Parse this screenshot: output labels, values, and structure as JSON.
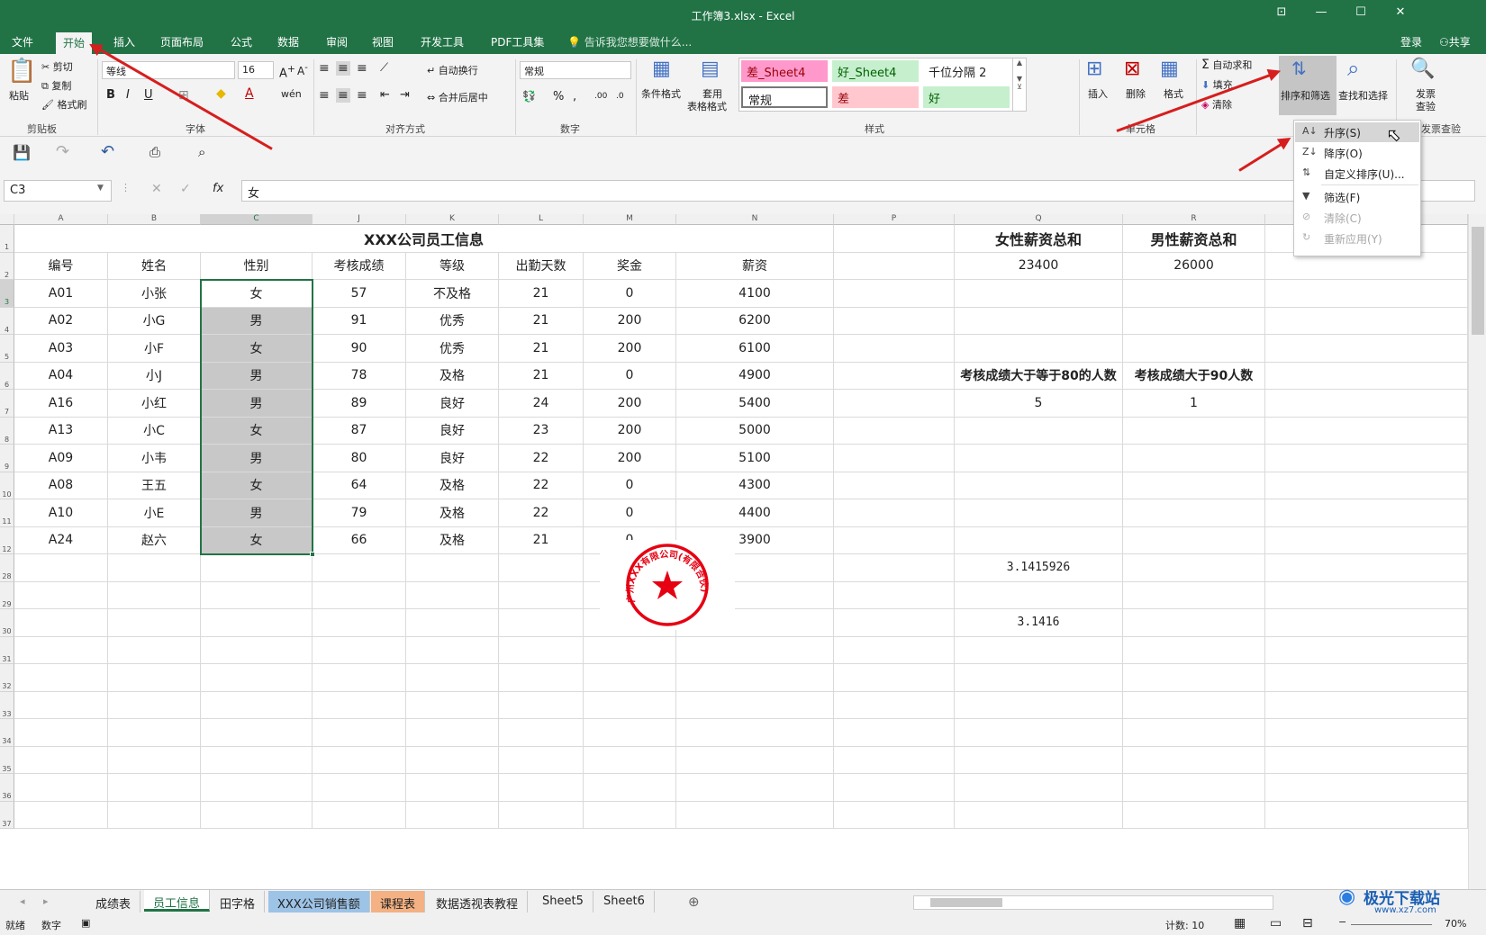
{
  "window": {
    "title": "工作簿3.xlsx - Excel"
  },
  "tabs": [
    "文件",
    "开始",
    "插入",
    "页面布局",
    "公式",
    "数据",
    "审阅",
    "视图",
    "开发工具",
    "PDF工具集"
  ],
  "tell_me": "告诉我您想要做什么...",
  "account": {
    "login": "登录",
    "share": "共享"
  },
  "ribbon": {
    "clipboard": {
      "paste": "粘贴",
      "cut": "剪切",
      "copy": "复制",
      "format_painter": "格式刷",
      "label": "剪贴板"
    },
    "font": {
      "name": "等线",
      "size": "16",
      "label": "字体"
    },
    "alignment": {
      "wrap": "自动换行",
      "merge": "合并后居中",
      "label": "对齐方式"
    },
    "number": {
      "format": "常规",
      "label": "数字"
    },
    "styles": {
      "conditional": "条件格式",
      "table1": "套用",
      "table2": "表格格式",
      "label": "样式",
      "gallery": [
        {
          "text": "差_Sheet4",
          "bg": "#ff99cc",
          "fg": "#9c0006"
        },
        {
          "text": "好_Sheet4",
          "bg": "#c6efce",
          "fg": "#006100"
        },
        {
          "text": "千位分隔 2",
          "bg": "#ffffff",
          "fg": "#222222"
        },
        {
          "text": "常规",
          "bg": "#ffffff",
          "fg": "#222222"
        },
        {
          "text": "差",
          "bg": "#ffc7ce",
          "fg": "#9c0006"
        },
        {
          "text": "好",
          "bg": "#c6efce",
          "fg": "#006100"
        }
      ]
    },
    "cells": {
      "insert": "插入",
      "delete": "删除",
      "format": "格式",
      "label": "单元格"
    },
    "editing": {
      "autosum": "自动求和",
      "fill": "填充",
      "clear": "清除",
      "sort_filter": "排序和筛选",
      "find_select": "查找和选择"
    },
    "invoice": {
      "line1": "发票",
      "line2": "查验",
      "label": "发票查验"
    }
  },
  "namebox": "C3",
  "formula": "女",
  "sheet": {
    "col_letters": [
      "A",
      "B",
      "C",
      "J",
      "K",
      "L",
      "M",
      "N",
      "P",
      "Q",
      "R"
    ],
    "row_numbers": [
      "1",
      "2",
      "3",
      "4",
      "5",
      "6",
      "7",
      "8",
      "9",
      "10",
      "11",
      "12",
      "28",
      "29",
      "30",
      "31",
      "32",
      "33",
      "34",
      "35",
      "36",
      "37"
    ],
    "title": "XXX公司员工信息",
    "headers": [
      "编号",
      "姓名",
      "性别",
      "考核成绩",
      "等级",
      "出勤天数",
      "奖金",
      "薪资"
    ],
    "rows": [
      [
        "A01",
        "小张",
        "女",
        "57",
        "不及格",
        "21",
        "0",
        "4100"
      ],
      [
        "A02",
        "小G",
        "男",
        "91",
        "优秀",
        "21",
        "200",
        "6200"
      ],
      [
        "A03",
        "小F",
        "女",
        "90",
        "优秀",
        "21",
        "200",
        "6100"
      ],
      [
        "A04",
        "小J",
        "男",
        "78",
        "及格",
        "21",
        "0",
        "4900"
      ],
      [
        "A16",
        "小红",
        "男",
        "89",
        "良好",
        "24",
        "200",
        "5400"
      ],
      [
        "A13",
        "小C",
        "女",
        "87",
        "良好",
        "23",
        "200",
        "5000"
      ],
      [
        "A09",
        "小韦",
        "男",
        "80",
        "良好",
        "22",
        "200",
        "5100"
      ],
      [
        "A08",
        "王五",
        "女",
        "64",
        "及格",
        "22",
        "0",
        "4300"
      ],
      [
        "A10",
        "小E",
        "男",
        "79",
        "及格",
        "22",
        "0",
        "4400"
      ],
      [
        "A24",
        "赵六",
        "女",
        "66",
        "及格",
        "21",
        "0",
        "3900"
      ]
    ],
    "female_total_label": "女性薪资总和",
    "male_total_label": "男性薪资总和",
    "female_total": "23400",
    "male_total": "26000",
    "count80_label": "考核成绩大于等于80的人数",
    "count90_label": "考核成绩大于90人数",
    "count80": "5",
    "count90": "1",
    "pi_long": "3.1415926",
    "pi_short": "3.1416",
    "stamp_text": "广州XXX有限公司(有限合伙)"
  },
  "sort_menu": [
    {
      "label": "升序(S)",
      "enabled": true,
      "icon": "sort-ascending-icon"
    },
    {
      "label": "降序(O)",
      "enabled": true,
      "icon": "sort-descending-icon"
    },
    {
      "label": "自定义排序(U)...",
      "enabled": true,
      "icon": "custom-sort-icon"
    },
    {
      "label": "筛选(F)",
      "enabled": true,
      "icon": "filter-icon"
    },
    {
      "label": "清除(C)",
      "enabled": false,
      "icon": "clear-filter-icon"
    },
    {
      "label": "重新应用(Y)",
      "enabled": false,
      "icon": "reapply-icon"
    }
  ],
  "sheet_tabs": [
    {
      "name": "成绩表",
      "bg": "#f0f0f0"
    },
    {
      "name": "员工信息",
      "bg": "#ffffff",
      "active": true
    },
    {
      "name": "田字格",
      "bg": "#f0f0f0"
    },
    {
      "name": "XXX公司销售额",
      "bg": "#9dc3e6"
    },
    {
      "name": "课程表",
      "bg": "#f4b183"
    },
    {
      "name": "数据透视表教程",
      "bg": "#f0f0f0"
    },
    {
      "name": "Sheet5",
      "bg": "#f0f0f0"
    },
    {
      "name": "Sheet6",
      "bg": "#f0f0f0"
    }
  ],
  "status": {
    "ready": "就绪",
    "numlock": "数字",
    "count": "计数: 10",
    "zoom": "70%"
  },
  "watermark": {
    "name": "极光下载站",
    "url": "www.xz7.com"
  },
  "colors": {
    "excel_green": "#217346",
    "selected_gray": "#c8c8c8",
    "arrow_red": "#d61e1e",
    "stamp_red": "#e60012"
  }
}
